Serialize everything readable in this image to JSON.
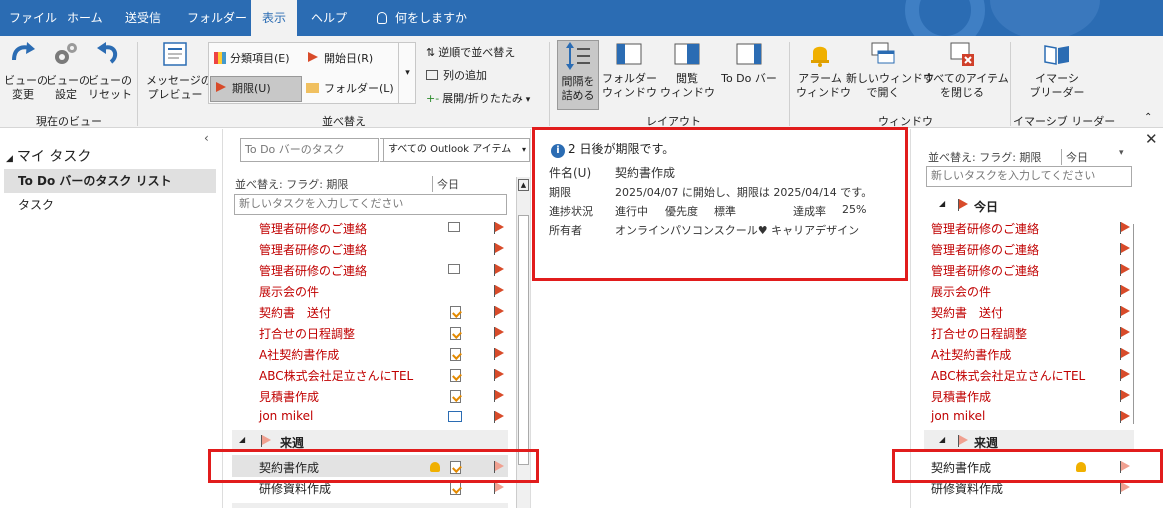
{
  "tabs": [
    "ファイル",
    "ホーム",
    "送受信",
    "フォルダー",
    "表示",
    "ヘルプ"
  ],
  "tell_me": "何をしますか",
  "ribbon": {
    "current_view": {
      "change": "ビューの\n変更",
      "settings": "ビューの\n設定",
      "reset": "ビューの\nリセット",
      "group": "現在のビュー"
    },
    "arrange": {
      "message_preview": "メッセージの\nプレビュー",
      "category": "分類項目(E)",
      "start_date": "開始日(R)",
      "due": "期限(U)",
      "folder": "フォルダー(L)",
      "reverse": "逆順で並べ替え",
      "add_columns": "列の追加",
      "expand": "展開/折りたたみ",
      "group": "並べ替え"
    },
    "layout": {
      "spacing": "間隔を\n詰める",
      "folder_pane": "フォルダー\nウィンドウ",
      "reading_pane": "閲覧\nウィンドウ",
      "todo_bar": "To Do バー",
      "group": "レイアウト"
    },
    "window": {
      "reminders": "アラーム\nウィンドウ",
      "open_new": "新しいウィンドウ\nで開く",
      "close_all": "すべてのアイテム\nを閉じる",
      "group": "ウィンドウ"
    },
    "immersive": {
      "reader": "イマーシ\nブリーダー",
      "group": "イマーシブ リーダー"
    }
  },
  "nav": {
    "my_tasks": "マイ タスク",
    "items": [
      "To Do バーのタスク リスト",
      "タスク"
    ]
  },
  "list": {
    "search_placeholder": "To Do バーのタスク",
    "scope": "すべての Outlook アイテム",
    "sort_label": "並べ替え: フラグ: 期限",
    "sort_value": "今日",
    "new_task_placeholder": "新しいタスクを入力してください",
    "today_items": [
      "管理者研修のご連絡",
      "管理者研修のご連絡",
      "管理者研修のご連絡",
      "展示会の件",
      "契約書　送付",
      "打合せの日程調整",
      "A社契約書作成",
      "ABC株式会社足立さんにTEL",
      "見積書作成",
      "jon mikel"
    ],
    "next_week_group": "来週",
    "next_week_items": [
      "契約書作成",
      "研修資料作成"
    ]
  },
  "preview": {
    "info": "2 日後が期限です。",
    "subject_label": "件名(U)",
    "subject": "契約書作成",
    "due_label": "期限",
    "due": "2025/04/07 に開始し、期限は 2025/04/14 です。",
    "status_label": "進捗状況",
    "status": "進行中",
    "priority_label": "優先度",
    "priority": "標準",
    "percent_label": "達成率",
    "percent": "25%",
    "owner_label": "所有者",
    "owner": "オンラインパソコンスクール♥ キャリアデザイン"
  },
  "todobar": {
    "sort_label": "並べ替え: フラグ: 期限",
    "sort_value": "今日",
    "new_task_placeholder": "新しいタスクを入力してください",
    "today_group": "今日"
  }
}
